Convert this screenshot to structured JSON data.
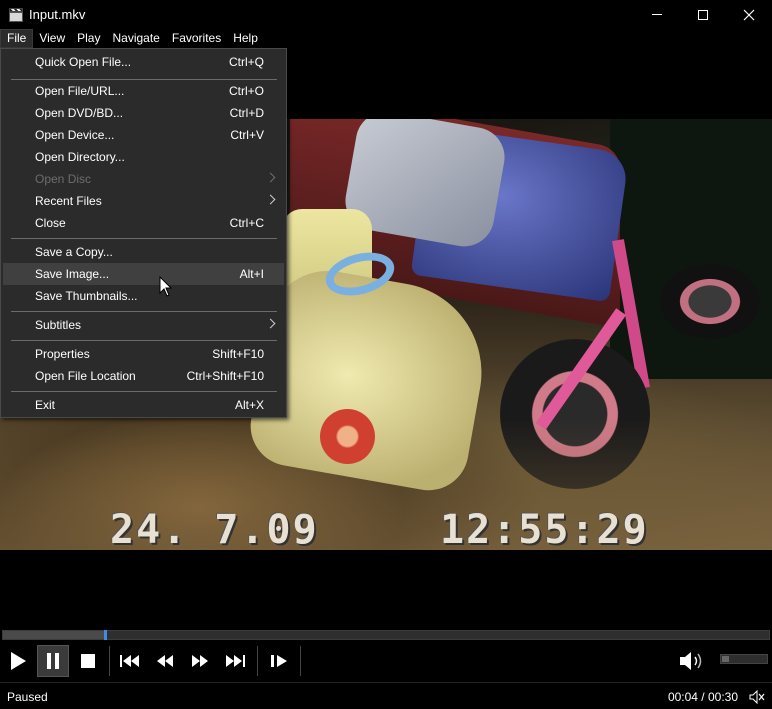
{
  "window": {
    "title": "Input.mkv",
    "icon": "clapperboard-icon"
  },
  "menubar": {
    "items": [
      "File",
      "View",
      "Play",
      "Navigate",
      "Favorites",
      "Help"
    ],
    "active": "File"
  },
  "file_menu": {
    "items": [
      {
        "label": "Quick Open File...",
        "shortcut": "Ctrl+Q"
      },
      {
        "label": "Open File/URL...",
        "shortcut": "Ctrl+O"
      },
      {
        "label": "Open DVD/BD...",
        "shortcut": "Ctrl+D"
      },
      {
        "label": "Open Device...",
        "shortcut": "Ctrl+V"
      },
      {
        "label": "Open Directory...",
        "shortcut": ""
      },
      {
        "label": "Open Disc",
        "shortcut": "",
        "submenu": true,
        "disabled": true
      },
      {
        "label": "Recent Files",
        "shortcut": "",
        "submenu": true
      },
      {
        "label": "Close",
        "shortcut": "Ctrl+C"
      },
      {
        "label": "Save a Copy...",
        "shortcut": ""
      },
      {
        "label": "Save Image...",
        "shortcut": "Alt+I",
        "highlighted": true
      },
      {
        "label": "Save Thumbnails...",
        "shortcut": ""
      },
      {
        "label": "Subtitles",
        "shortcut": "",
        "submenu": true
      },
      {
        "label": "Properties",
        "shortcut": "Shift+F10"
      },
      {
        "label": "Open File Location",
        "shortcut": "Ctrl+Shift+F10"
      },
      {
        "label": "Exit",
        "shortcut": "Alt+X"
      }
    ]
  },
  "video": {
    "overlay_date": "24. 7.09",
    "overlay_time": "12:55:29"
  },
  "seekbar": {
    "progress": 0.1333
  },
  "controls": {
    "buttons": [
      "play-icon",
      "pause-icon",
      "stop-icon",
      "skip-back-icon",
      "rewind-icon",
      "fast-forward-icon",
      "skip-forward-icon",
      "frame-step-icon"
    ],
    "pressed": "pause-icon",
    "volume_icon": "volume-icon",
    "volume_level": 0.15
  },
  "status": {
    "state": "Paused",
    "time": "00:04 / 00:30",
    "mute_icon": "mute-icon"
  },
  "colors": {
    "accent": "#3a8ee6",
    "menu_bg": "#2b2b2b",
    "menu_highlight": "#404040",
    "disabled_text": "#6d6d6d"
  }
}
